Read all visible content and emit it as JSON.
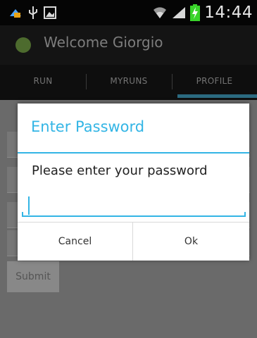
{
  "status_bar": {
    "time": "14:44",
    "icons": [
      "notification-icon",
      "usb-icon",
      "image-icon",
      "wifi-icon",
      "signal-icon",
      "battery-charging-icon"
    ]
  },
  "action_bar": {
    "title": "Welcome Giorgio",
    "icon": "android-icon"
  },
  "tabs": [
    {
      "label": "RUN"
    },
    {
      "label": "MYRUNS"
    },
    {
      "label": "PROFILE",
      "selected": true
    }
  ],
  "background_form": {
    "submit_label": "Submit"
  },
  "dialog": {
    "title": "Enter Password",
    "message": "Please enter your password",
    "password_value": "",
    "cancel_label": "Cancel",
    "ok_label": "Ok"
  },
  "colors": {
    "accent": "#33b5e5",
    "tab_indicator": "#2b6a80"
  }
}
